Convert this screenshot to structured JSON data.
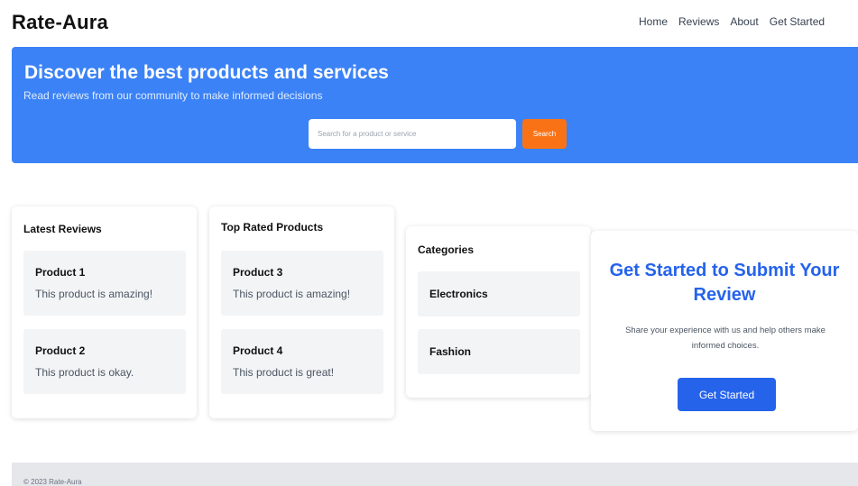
{
  "app": {
    "name": "Rate-Aura"
  },
  "nav": {
    "items": [
      "Home",
      "Reviews",
      "About",
      "Get Started"
    ]
  },
  "hero": {
    "title": "Discover the best products and services",
    "subtitle": "Read reviews from our community to make informed decisions",
    "search_placeholder": "Search for a product or service",
    "search_button": "Search",
    "background_color": "#3b82f6",
    "button_color": "#f97316"
  },
  "latest_reviews": {
    "title": "Latest Reviews",
    "items": [
      {
        "name": "Product 1",
        "text": "This product is amazing!"
      },
      {
        "name": "Product 2",
        "text": "This product is okay."
      }
    ]
  },
  "top_rated": {
    "title": "Top Rated Products",
    "items": [
      {
        "name": "Product 3",
        "text": "This product is amazing!"
      },
      {
        "name": "Product 4",
        "text": "This product is great!"
      }
    ]
  },
  "categories": {
    "title": "Categories",
    "items": [
      "Electronics",
      "Fashion"
    ]
  },
  "cta": {
    "title": "Get Started to Submit Your Review",
    "text": "Share your experience with us and help others make informed choices.",
    "button": "Get Started",
    "accent_color": "#2563eb"
  },
  "footer": {
    "text": "© 2023 Rate-Aura"
  }
}
